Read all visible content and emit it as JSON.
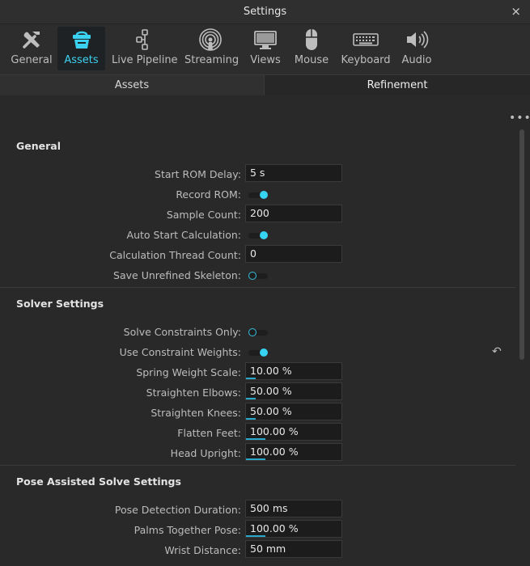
{
  "window": {
    "title": "Settings",
    "close_glyph": "×"
  },
  "toolbar": {
    "items": [
      {
        "label": "General",
        "icon": "tools-icon"
      },
      {
        "label": "Assets",
        "icon": "basket-icon",
        "active": true
      },
      {
        "label": "Live Pipeline",
        "icon": "pipeline-icon"
      },
      {
        "label": "Streaming",
        "icon": "broadcast-icon"
      },
      {
        "label": "Views",
        "icon": "monitor-icon"
      },
      {
        "label": "Mouse",
        "icon": "mouse-icon"
      },
      {
        "label": "Keyboard",
        "icon": "keyboard-icon"
      },
      {
        "label": "Audio",
        "icon": "speaker-icon"
      }
    ]
  },
  "subtabs": {
    "left": "Assets",
    "right": "Refinement"
  },
  "colors": {
    "accent": "#37d3f2",
    "background": "#292929"
  },
  "general": {
    "title": "General",
    "start_rom_delay": {
      "label": "Start ROM Delay:",
      "value": "5 s"
    },
    "record_rom": {
      "label": "Record ROM:",
      "on": true
    },
    "sample_count": {
      "label": "Sample Count:",
      "value": "200"
    },
    "auto_start_calc": {
      "label": "Auto Start Calculation:",
      "on": true
    },
    "calc_thread_count": {
      "label": "Calculation Thread Count:",
      "value": "0"
    },
    "save_unrefined": {
      "label": "Save Unrefined Skeleton:",
      "on": false
    }
  },
  "solver": {
    "title": "Solver Settings",
    "solve_constraints_only": {
      "label": "Solve Constraints Only:",
      "on": false
    },
    "use_constraint_weights": {
      "label": "Use Constraint Weights:",
      "on": true
    },
    "spring_weight_scale": {
      "label": "Spring Weight Scale:",
      "value": "10.00 %",
      "fill": 0.1
    },
    "straighten_elbows": {
      "label": "Straighten Elbows:",
      "value": "50.00 %",
      "fill": 0.1
    },
    "straighten_knees": {
      "label": "Straighten Knees:",
      "value": "50.00 %",
      "fill": 0.1
    },
    "flatten_feet": {
      "label": "Flatten Feet:",
      "value": "100.00 %",
      "fill": 0.2
    },
    "head_upright": {
      "label": "Head Upright:",
      "value": "100.00 %",
      "fill": 0.2
    }
  },
  "pose": {
    "title": "Pose Assisted Solve Settings",
    "pose_detection_duration": {
      "label": "Pose Detection Duration:",
      "value": "500 ms"
    },
    "palms_together_pose": {
      "label": "Palms Together Pose:",
      "value": "100.00 %",
      "fill": 0.2
    },
    "wrist_distance": {
      "label": "Wrist Distance:",
      "value": "50 mm"
    }
  }
}
